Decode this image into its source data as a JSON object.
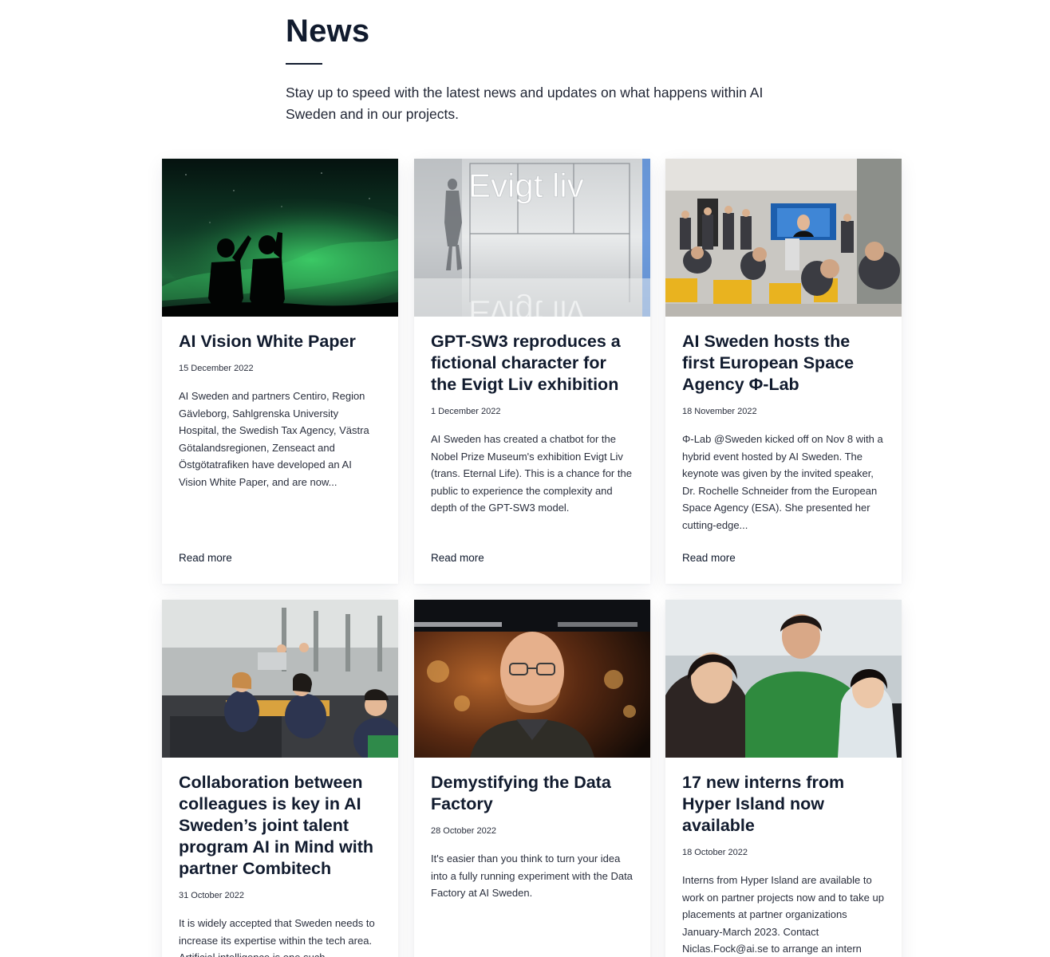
{
  "header": {
    "title": "News",
    "intro": "Stay up to speed with the latest news and updates on what happens within AI Sweden and in our projects."
  },
  "cards": [
    {
      "title": "AI Vision White Paper",
      "date": "15 December 2022",
      "excerpt": "AI Sweden and partners Centiro, Region Gävleborg, Sahlgrenska University Hospital, the Swedish Tax Agency, Västra Götalandsregionen, Zenseact and Östgötatrafiken have developed an AI Vision White Paper, and are now...",
      "read_more": "Read more",
      "image": "northern-lights-photo"
    },
    {
      "title": "GPT-SW3 reproduces a fictional character for the Evigt Liv exhibition",
      "date": "1 December 2022",
      "excerpt": "AI Sweden has created a chatbot for the Nobel Prize Museum's exhibition Evigt Liv (trans. Eternal Life). This is a chance for the public to experience the complexity and depth of the GPT-SW3 model.",
      "read_more": "Read more",
      "image": "exhibition-photo",
      "image_text": "Evigt liv"
    },
    {
      "title": "AI Sweden hosts the first European Space Agency Φ-Lab",
      "date": "18 November 2022",
      "excerpt": "Φ-Lab @Sweden kicked off on Nov 8 with a hybrid event hosted by AI Sweden. The keynote was given by the invited speaker, Dr. Rochelle Schneider from the European Space Agency (ESA). She presented her cutting-edge...",
      "read_more": "Read more",
      "image": "event-photo"
    },
    {
      "title": "Collaboration between colleagues is key in AI Sweden’s joint talent program AI in Mind with partner Combitech",
      "date": "31 October 2022",
      "excerpt": "It is widely accepted that Sweden needs to increase its expertise within the tech area. Artificial intelligence is one such",
      "image": "office-meeting-photo"
    },
    {
      "title": "Demystifying the Data Factory",
      "date": "28 October 2022",
      "excerpt": "It's easier than you think to turn your idea into a fully running experiment with the Data Factory at AI Sweden.",
      "image": "portrait-photo"
    },
    {
      "title": "17 new interns from Hyper Island now available",
      "date": "18 October 2022",
      "excerpt": "Interns from Hyper Island are available to work on partner projects now and to take up placements at partner organizations January-March 2023. Contact Niclas.Fock@ai.se to arrange an intern",
      "image": "interns-photo"
    }
  ],
  "colors": {
    "heading": "#111b2e",
    "text": "#2a2f3d",
    "background": "#ffffff"
  }
}
